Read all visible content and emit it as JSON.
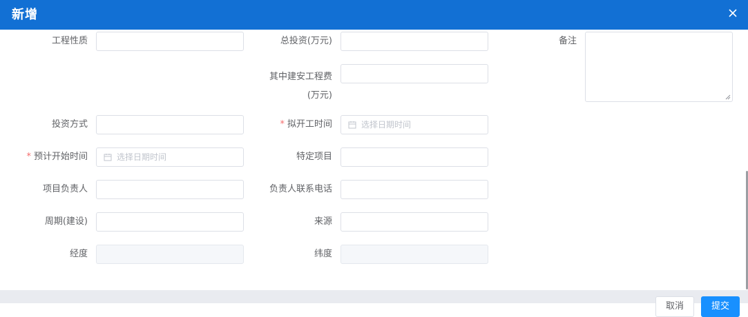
{
  "dialog": {
    "title": "新增",
    "close_icon": "close-icon"
  },
  "form": {
    "project_nature": {
      "label": "工程性质",
      "value": ""
    },
    "total_investment": {
      "label": "总投资(万元)",
      "value": ""
    },
    "remarks": {
      "label": "备注",
      "value": ""
    },
    "construction_cost": {
      "label_line1": "其中建安工程费",
      "label_line2": "(万元)",
      "value": ""
    },
    "investment_method": {
      "label": "投资方式",
      "value": ""
    },
    "planned_start_time": {
      "required_mark": "*",
      "label": "拟开工时间",
      "placeholder": "选择日期时间"
    },
    "expected_start_time": {
      "required_mark": "*",
      "label": "预计开始时间",
      "placeholder": "选择日期时间"
    },
    "specific_project": {
      "label": "特定项目",
      "value": ""
    },
    "project_lead": {
      "label": "项目负责人",
      "value": ""
    },
    "lead_phone": {
      "label": "负责人联系电话",
      "value": ""
    },
    "construction_period": {
      "label": "周期(建设)",
      "value": ""
    },
    "source": {
      "label": "来源",
      "value": ""
    },
    "longitude": {
      "label": "经度",
      "value": ""
    },
    "latitude": {
      "label": "纬度",
      "value": ""
    }
  },
  "footer": {
    "cancel_label": "取消",
    "submit_label": "提交"
  },
  "colors": {
    "header": "#1270d4",
    "primary_button": "#1890ff",
    "required": "#f56c6c"
  }
}
